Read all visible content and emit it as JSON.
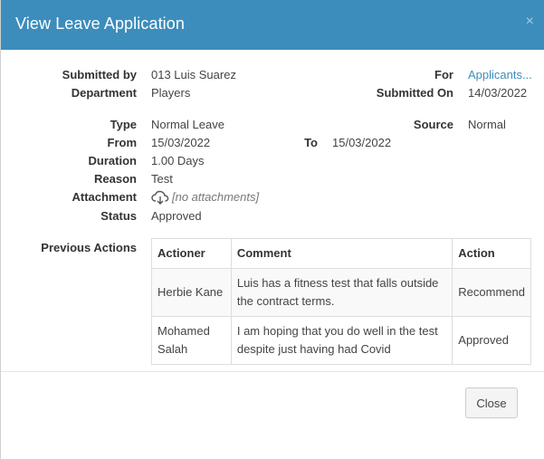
{
  "dialog": {
    "title": "View Leave Application",
    "close_symbol": "×"
  },
  "fields": {
    "submitted_by": {
      "label": "Submitted by",
      "value": "013 Luis Suarez"
    },
    "department": {
      "label": "Department",
      "value": "Players"
    },
    "for": {
      "label": "For",
      "value": "Applicants..."
    },
    "submitted_on": {
      "label": "Submitted On",
      "value": "14/03/2022"
    },
    "type": {
      "label": "Type",
      "value": "Normal Leave"
    },
    "source": {
      "label": "Source",
      "value": "Normal"
    },
    "from": {
      "label": "From",
      "value": "15/03/2022"
    },
    "to": {
      "label": "To",
      "value": "15/03/2022"
    },
    "duration": {
      "label": "Duration",
      "value": "1.00 Days"
    },
    "reason": {
      "label": "Reason",
      "value": "Test"
    },
    "attachment": {
      "label": "Attachment",
      "value": "[no attachments]",
      "icon": "cloud-download-icon"
    },
    "status": {
      "label": "Status",
      "value": "Approved"
    }
  },
  "previous_actions": {
    "label": "Previous Actions",
    "columns": [
      "Actioner",
      "Comment",
      "Action"
    ],
    "rows": [
      {
        "actioner": "Herbie Kane",
        "comment": "Luis has a fitness test that falls outside the contract terms.",
        "action": "Recommend"
      },
      {
        "actioner": "Mohamed Salah",
        "comment": "I am hoping that you do well in the test despite just having had Covid",
        "action": "Approved"
      }
    ]
  },
  "footer": {
    "close_label": "Close"
  }
}
